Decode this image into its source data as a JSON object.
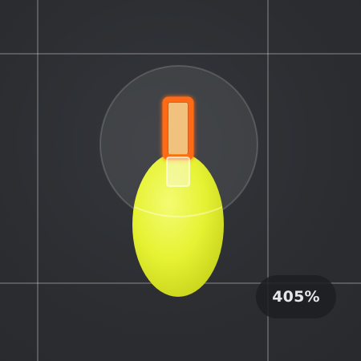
{
  "viewport": {
    "zoom_label": "405%",
    "background_color": "#2b2d31",
    "grid_line_color": "#5a5c61"
  },
  "sprite": {
    "body_color": "#e6f233",
    "body_highlight": "#f4fb72",
    "wick_outline_color": "#ff6a13",
    "wick_fill_color": "#f0c27e",
    "glow_ring_color": "#4a4c51"
  }
}
